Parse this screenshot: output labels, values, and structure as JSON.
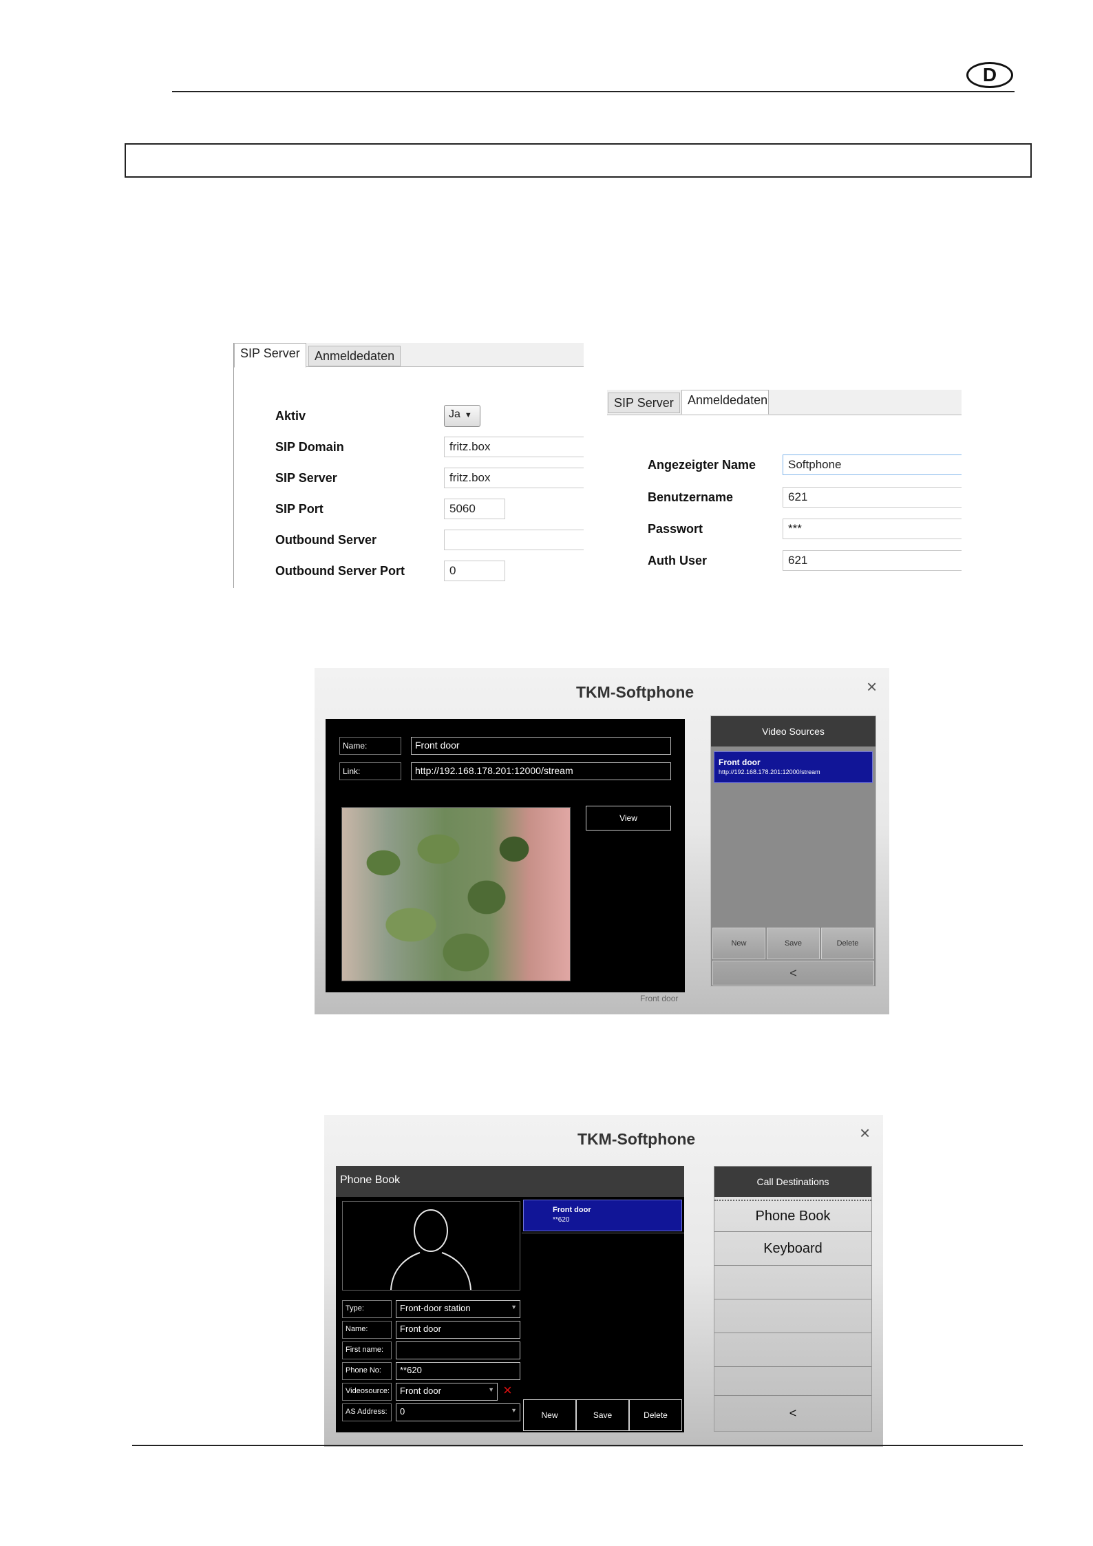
{
  "page": {
    "language_badge": "D"
  },
  "sip_server_panel": {
    "tabs": [
      {
        "label": "SIP Server",
        "active": true
      },
      {
        "label": "Anmeldedaten",
        "active": false
      }
    ],
    "fields": {
      "aktiv": {
        "label": "Aktiv",
        "value": "Ja"
      },
      "sip_domain": {
        "label": "SIP Domain",
        "value": "fritz.box"
      },
      "sip_server": {
        "label": "SIP Server",
        "value": "fritz.box"
      },
      "sip_port": {
        "label": "SIP Port",
        "value": "5060"
      },
      "outbound_server": {
        "label": "Outbound Server",
        "value": ""
      },
      "outbound_server_port": {
        "label": "Outbound Server Port",
        "value": "0"
      }
    }
  },
  "login_panel": {
    "tabs": [
      {
        "label": "SIP Server",
        "active": false
      },
      {
        "label": "Anmeldedaten",
        "active": true
      }
    ],
    "fields": {
      "display_name": {
        "label": "Angezeigter Name",
        "value": "Softphone"
      },
      "username": {
        "label": "Benutzername",
        "value": "621"
      },
      "password": {
        "label": "Passwort",
        "value": "***"
      },
      "auth_user": {
        "label": "Auth User",
        "value": "621"
      }
    }
  },
  "video_window": {
    "title": "TKM-Softphone",
    "close_glyph": "×",
    "form": {
      "name_label": "Name:",
      "name_value": "Front door",
      "link_label": "Link:",
      "link_value": "http://192.168.178.201:12000/stream",
      "view_button": "View"
    },
    "preview_caption": "Front door",
    "sources": {
      "header": "Video Sources",
      "items": [
        {
          "name": "Front door",
          "url": "http://192.168.178.201:12000/stream",
          "selected": true
        }
      ],
      "buttons": {
        "new": "New",
        "save": "Save",
        "delete": "Delete",
        "back": "<"
      }
    }
  },
  "phonebook_window": {
    "title": "TKM-Softphone",
    "close_glyph": "×",
    "header": "Phone Book",
    "entries": [
      {
        "name": "Front door",
        "number": "**620",
        "selected": true
      }
    ],
    "form": {
      "type_label": "Type:",
      "type_value": "Front-door station",
      "name_label": "Name:",
      "name_value": "Front door",
      "first_name_label": "First name:",
      "first_name_value": "",
      "phone_label": "Phone No:",
      "phone_value": "**620",
      "videosource_label": "Videosource:",
      "videosource_value": "Front door",
      "as_address_label": "AS Address:",
      "as_address_value": "0",
      "clear_glyph": "×"
    },
    "buttons": {
      "new": "New",
      "save": "Save",
      "delete": "Delete"
    },
    "call_destinations": {
      "header": "Call Destinations",
      "items": [
        "Phone Book",
        "Keyboard"
      ],
      "back": "<"
    },
    "colors": {
      "selection": "#111597"
    }
  }
}
